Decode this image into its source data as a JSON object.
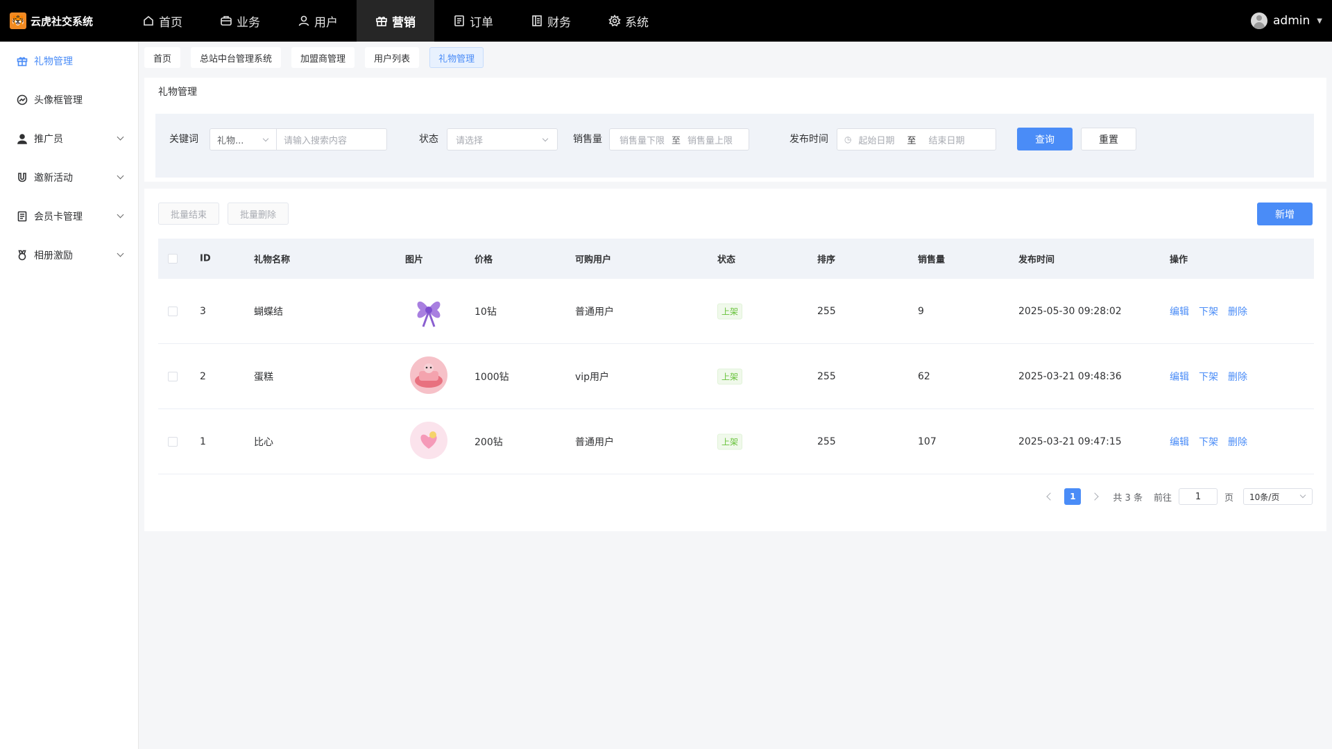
{
  "app": {
    "name": "云虎社交系统",
    "logo_icon": "tiger-logo-icon",
    "brand_color": "#f08a24"
  },
  "topnav": [
    {
      "label": "首页",
      "icon": "home-icon"
    },
    {
      "label": "业务",
      "icon": "briefcase-icon"
    },
    {
      "label": "用户",
      "icon": "user-icon"
    },
    {
      "label": "营销",
      "icon": "gift-icon",
      "active": true
    },
    {
      "label": "订单",
      "icon": "document-icon"
    },
    {
      "label": "财务",
      "icon": "ledger-icon"
    },
    {
      "label": "系统",
      "icon": "gear-icon"
    }
  ],
  "user": {
    "name": "admin"
  },
  "sidebar": [
    {
      "label": "礼物管理",
      "icon": "gift-icon",
      "active": true
    },
    {
      "label": "头像框管理",
      "icon": "avatar-frame-icon"
    },
    {
      "label": "推广员",
      "icon": "person-icon",
      "expandable": true
    },
    {
      "label": "邀新活动",
      "icon": "magnet-icon",
      "expandable": true
    },
    {
      "label": "会员卡管理",
      "icon": "card-icon",
      "expandable": true
    },
    {
      "label": "相册激励",
      "icon": "medal-icon",
      "expandable": true
    }
  ],
  "tags": [
    "首页",
    "总站中台管理系统",
    "加盟商管理",
    "用户列表",
    "礼物管理"
  ],
  "page_title": "礼物管理",
  "filters": {
    "keyword_label": "关键词",
    "keyword_type": "礼物...",
    "keyword_placeholder": "请输入搜索内容",
    "status_label": "状态",
    "status_placeholder": "请选择",
    "sales_label": "销售量",
    "sales_min_placeholder": "销售量下限",
    "sales_sep": "至",
    "sales_max_placeholder": "销售量上限",
    "date_label": "发布时间",
    "date_start_placeholder": "起始日期",
    "date_sep": "至",
    "date_end_placeholder": "结束日期",
    "query_btn": "查询",
    "reset_btn": "重置"
  },
  "actions": {
    "batch_end": "批量结束",
    "batch_delete": "批量删除",
    "add": "新增"
  },
  "table": {
    "headers": [
      "ID",
      "礼物名称",
      "图片",
      "价格",
      "可购用户",
      "状态",
      "排序",
      "销售量",
      "发布时间",
      "操作"
    ],
    "rows": [
      {
        "id": "3",
        "name": "蝴蝶结",
        "image": "bow-gift-image",
        "price": "10钻",
        "users": "普通用户",
        "status": "上架",
        "sort": "255",
        "sales": "9",
        "time": "2025-05-30 09:28:02"
      },
      {
        "id": "2",
        "name": "蛋糕",
        "image": "cake-gift-image",
        "price": "1000钻",
        "users": "vip用户",
        "status": "上架",
        "sort": "255",
        "sales": "62",
        "time": "2025-03-21 09:48:36"
      },
      {
        "id": "1",
        "name": "比心",
        "image": "heart-gift-image",
        "price": "200钻",
        "users": "普通用户",
        "status": "上架",
        "sort": "255",
        "sales": "107",
        "time": "2025-03-21 09:47:15"
      }
    ],
    "ops": [
      "编辑",
      "下架",
      "删除"
    ]
  },
  "pagination": {
    "current": "1",
    "total": "共 3 条",
    "goto_label": "前往",
    "goto_value": "1",
    "page_unit": "页",
    "page_size": "10条/页"
  },
  "colors": {
    "accent": "#4a8cf7",
    "success": "#67c23a"
  }
}
